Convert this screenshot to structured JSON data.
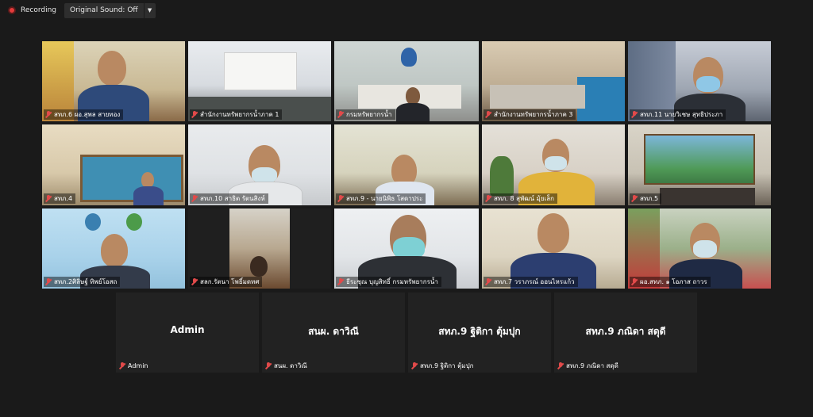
{
  "topbar": {
    "recording_label": "Recording",
    "sound_label": "Original Sound: Off"
  },
  "tiles": [
    {
      "name": "สทภ.6 ผอ.สุพล สายทอง"
    },
    {
      "name": "สำนักงานทรัพยากรน้ำภาค 1"
    },
    {
      "name": "กรมทรัพยากรน้ำ"
    },
    {
      "name": "สำนักงานทรัพยากรน้ำภาค 3"
    },
    {
      "name": "สทภ.11 นายวิเชษ สุทธิประภา"
    },
    {
      "name": "สทภ.4"
    },
    {
      "name": "สทภ.10 สาธิต รัตนสิงห์"
    },
    {
      "name": "สทภ.9 - นายนิพิธ โสดาประ"
    },
    {
      "name": "สทภ. 8 สุพัฒน์ มุ้ยเล็ก"
    },
    {
      "name": "สทภ.5"
    },
    {
      "name": "สทภ.2ศิลิษฐ์ ทิพย์โอสถ"
    },
    {
      "name": "สลก.รัตนา โพธิ์มดทศ"
    },
    {
      "name": "ธีระชุณ บุญสิทธิ์ กรมทรัพยากรน้ำ"
    },
    {
      "name": "สทภ.7 วราภรณ์ ออนไหรแก้ว"
    },
    {
      "name": "ผอ.สทภ. ๑ โอภาส ถาวร"
    }
  ],
  "name_tiles": [
    {
      "display": "Admin",
      "name": "Admin"
    },
    {
      "display": "สนผ. ดาวิณี",
      "name": "สนผ. ดาวิณี"
    },
    {
      "display": "สทภ.9 ฐิติกา ตุ้มปุก",
      "name": "สทภ.9 ฐิติกา ตุ้มปุก"
    },
    {
      "display": "สทภ.9 ภณิดา สดุดี",
      "name": "สทภ.9 ภณิดา สดุดี"
    }
  ]
}
